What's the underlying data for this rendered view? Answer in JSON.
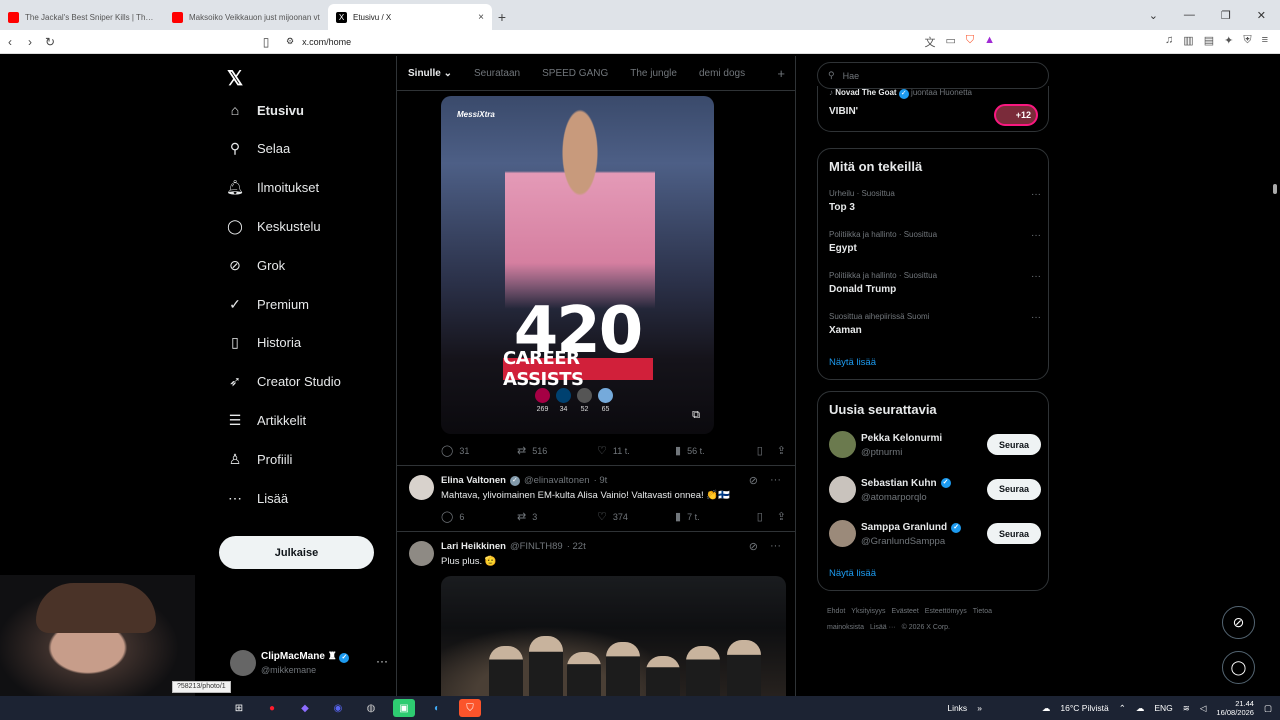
{
  "browser": {
    "tabs": [
      {
        "title": "The Jackal's Best Sniper Kills | The Da",
        "color": "#ff0000"
      },
      {
        "title": "Maksoiko Veikkauon just mijoonan vt",
        "color": "#ff0000"
      },
      {
        "title": "Etusivu / X",
        "color": "#000000",
        "close": "×"
      }
    ],
    "new_tab": "+",
    "url": "x.com/home"
  },
  "nav": {
    "logo": "𝕏",
    "items": [
      {
        "label": "Etusivu",
        "icon": "⌂",
        "icon_name": "home-icon"
      },
      {
        "label": "Selaa",
        "icon": "⚲",
        "icon_name": "search-icon"
      },
      {
        "label": "Ilmoitukset",
        "icon": "🔔︎",
        "icon_name": "bell-icon"
      },
      {
        "label": "Keskustelu",
        "icon": "◯",
        "icon_name": "chat-icon"
      },
      {
        "label": "Grok",
        "icon": "⊘",
        "icon_name": "grok-icon"
      },
      {
        "label": "Premium",
        "icon": "✓",
        "icon_name": "premium-icon"
      },
      {
        "label": "Historia",
        "icon": "▯",
        "icon_name": "bookmark-icon"
      },
      {
        "label": "Creator Studio",
        "icon": "➶",
        "icon_name": "rocket-icon"
      },
      {
        "label": "Artikkelit",
        "icon": "☰",
        "icon_name": "articles-icon"
      },
      {
        "label": "Profiili",
        "icon": "♙",
        "icon_name": "profile-icon"
      },
      {
        "label": "Lisää",
        "icon": "⋯",
        "icon_name": "more-icon"
      }
    ],
    "post_button": "Julkaise",
    "account": {
      "name": "ClipMacMane",
      "handle": "@mikkemane"
    }
  },
  "feed": {
    "tabs": [
      "Sinulle",
      "Seurataan",
      "SPEED GANG",
      "The jungle",
      "demi dogs"
    ],
    "active_tab": "Sinulle",
    "media": {
      "watermark": "MessiXtra",
      "big_number": "420",
      "caption": "CAREER ASSISTS",
      "clubs": [
        {
          "value": "269",
          "color": "#a50044"
        },
        {
          "value": "34",
          "color": "#004170"
        },
        {
          "value": "52",
          "color": "#555555"
        },
        {
          "value": "65",
          "color": "#75aadb"
        }
      ]
    },
    "post1_actions": {
      "replies": "31",
      "reposts": "516",
      "likes": "11 t.",
      "views": "56 t."
    },
    "post2": {
      "name": "Elina Valtonen",
      "handle": "@elinavaltonen",
      "time": "· 9t",
      "text": "Mahtava, ylivoimainen EM-kulta Alisa Vainio! Valtavasti onnea! 👏🇫🇮",
      "replies": "6",
      "reposts": "3",
      "likes": "374",
      "views": "7 t."
    },
    "post3": {
      "name": "Lari Heikkinen",
      "handle": "@FINLTH89",
      "time": "· 22t",
      "text": "Plus plus. 🫡"
    }
  },
  "right": {
    "search_placeholder": "Hae",
    "live": {
      "name": "Novad The Goat",
      "action": "juontaa Huonetta",
      "title": "VIBIN'",
      "count": "+12"
    },
    "trends_title": "Mitä on tekeillä",
    "trends": [
      {
        "meta": "Urheilu · Suosittua",
        "name": "Top 3"
      },
      {
        "meta": "Politiikka ja hallinto · Suosittua",
        "name": "Egypt"
      },
      {
        "meta": "Politiikka ja hallinto · Suosittua",
        "name": "Donald Trump"
      },
      {
        "meta": "Suosittua aihepiirissä Suomi",
        "name": "Xaman"
      }
    ],
    "show_more": "Näytä lisää",
    "who_title": "Uusia seurattavia",
    "who": [
      {
        "name": "Pekka Kelonurmi",
        "handle": "@ptnurmi",
        "verified": false,
        "color": "#6b7a4e"
      },
      {
        "name": "Sebastian Kuhn",
        "handle": "@atomarporqlo",
        "verified": true,
        "color": "#c9c3bd"
      },
      {
        "name": "Samppa Granlund",
        "handle": "@GranlundSamppa",
        "verified": true,
        "color": "#9b8a7a"
      }
    ],
    "follow_label": "Seuraa",
    "footer": [
      "Ehdot",
      "Yksityisyys",
      "Evästeet",
      "Esteettömyys",
      "Tietoa mainoksista",
      "Lisää ···",
      "© 2026 X Corp."
    ]
  },
  "tooltip": "?58213/photo/1",
  "taskbar": {
    "links": "Links",
    "weather": "16°C Pilvistä",
    "lang": "ENG",
    "time": "21.44",
    "date": "16/08/2026"
  }
}
